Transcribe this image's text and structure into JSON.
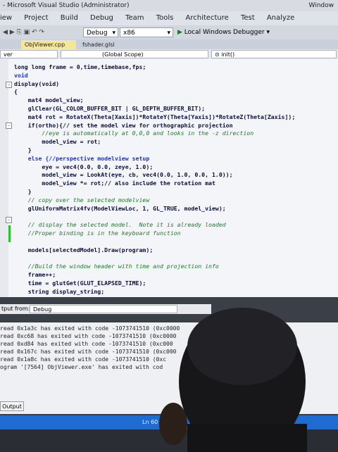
{
  "window": {
    "title": "- Microsoft Visual Studio (Administrator)",
    "title_extra": "Window"
  },
  "menu": {
    "items": [
      "iew",
      "Project",
      "Build",
      "Debug",
      "Team",
      "Tools",
      "Architecture",
      "Test",
      "Analyze"
    ],
    "debugger_label": "Local Windows Debugger",
    "debugger_arrow": "▶"
  },
  "toolbar": {
    "config_value": "Debug",
    "platform_value": "x86"
  },
  "tabs": {
    "active": "ObjViewer.cpp",
    "active_pin": "⊕",
    "active_close": "✕",
    "inactive": "fshader.glsl"
  },
  "navbar": {
    "left_value": "ver",
    "scope_value": "(Global Scope)",
    "member_value": "init()"
  },
  "code": {
    "lines": [
      "long long frame = 0,time,timebase,fps;",
      "void",
      "display(void)",
      "{",
      "    mat4 model_view;",
      "    glClear(GL_COLOR_BUFFER_BIT | GL_DEPTH_BUFFER_BIT);",
      "    mat4 rot = RotateX(Theta[Xaxis])*RotateY(Theta[Yaxis])*RotateZ(Theta[Zaxis]);",
      "    if(ortho){// set the model view for orthographic projection",
      "        //eye is automatically at 0,0,0 and looks in the -z direction",
      "        model_view = rot;",
      "    }",
      "    else {//perspective modelview setup",
      "        eye = vec4(0.0, 0.0, zeye, 1.0);",
      "        model_view = LookAt(eye, cb, vec4(0.0, 1.0, 0.0, 1.0));",
      "        model_view *= rot;// also include the rotation mat",
      "    }",
      "    // copy over the selected modelview",
      "    glUniformMatrix4fv(ModelViewLoc, 1, GL_TRUE, model_view);",
      "",
      "    // display the selected model.  Note it is already loaded",
      "    //Proper binding is in the keyboard function",
      "",
      "    models[selectedModel].Draw(program);",
      "",
      "    //Build the window header with time and projection info",
      "    frame++;",
      "    time = glutGet(GLUT_ELAPSED_TIME);",
      "    string display_string;"
    ],
    "comment_lines": [
      8,
      16,
      19,
      20,
      24
    ]
  },
  "output": {
    "show_output_from_label": "tput from:",
    "source_value": "Debug",
    "lines": [
      "read 0x1a3c has exited with code -1073741510 (0xc0000",
      "read 0xc68 has exited with code -1073741510 (0xc0000",
      "read 0xd84 has exited with code -1073741510 (0xc000",
      "read 0x167c has exited with code -1073741510 (0xc000",
      "read 0x1a8c has exited with code -1073741510 (0xc",
      "ogram '[7564] ObjViewer.exe' has exited with cod"
    ],
    "tab_label": "Output"
  },
  "status": {
    "position": "Ln 60"
  },
  "colors": {
    "status_blue": "#1e6bd2",
    "active_tab": "#f5e69a",
    "comment_green": "#1d7a2a",
    "keyword_blue": "#1d33c8"
  }
}
